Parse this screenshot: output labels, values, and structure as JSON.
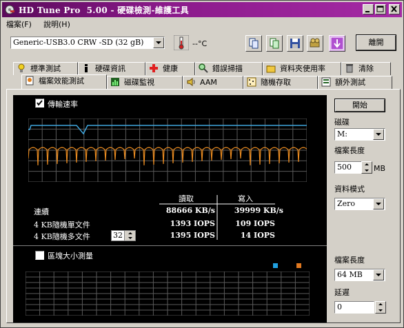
{
  "window": {
    "title": "HD Tune Pro  5.00 - 硬碟檢測-維護工具"
  },
  "menu": [
    "檔案(F)",
    "說明(H)"
  ],
  "toolbar": {
    "drive": "Generic-USB3.0 CRW   -SD (32 gB)",
    "temperature": "--°C",
    "exit_label": "離開"
  },
  "tabs_row1": [
    "標準測試",
    "硬碟資訊",
    "健康",
    "錯誤掃描",
    "資料夾使用率",
    "清除"
  ],
  "tabs_row2": [
    "檔案效能測試",
    "磁碟監視",
    "AAM",
    "隨機存取",
    "額外測試"
  ],
  "transfer": {
    "checkbox_label": "傳輸速率",
    "checked": true
  },
  "stats": {
    "col_read": "讀取",
    "col_write": "寫入",
    "rows": [
      {
        "label": "連續",
        "read": "88666 KB/s",
        "write": "39999 KB/s"
      },
      {
        "label": "4 KB隨機單文件",
        "read": "1393 IOPS",
        "write": "109 IOPS"
      },
      {
        "label": "4 KB隨機多文件",
        "read": "1395 IOPS",
        "write": "14 IOPS"
      }
    ],
    "queue_depth": "32"
  },
  "block": {
    "checkbox_label": "區塊大小測量",
    "checked": false
  },
  "right_panel": {
    "start_label": "開始",
    "drive_label": "磁碟",
    "drive_value": "M:",
    "file_length_label": "檔案長度",
    "file_length_value": "500",
    "file_length_unit": "MB",
    "data_mode_label": "資料模式",
    "data_mode_value": "Zero",
    "file_length2_label": "檔案長度",
    "file_length2_value": "64 MB",
    "delay_label": "延遲",
    "delay_value": "0"
  },
  "colors": {
    "title_bar": "#8a1a8a",
    "read_series": "#40a8e0",
    "write_series": "#e88a20",
    "grid": "#5a5a5a"
  }
}
